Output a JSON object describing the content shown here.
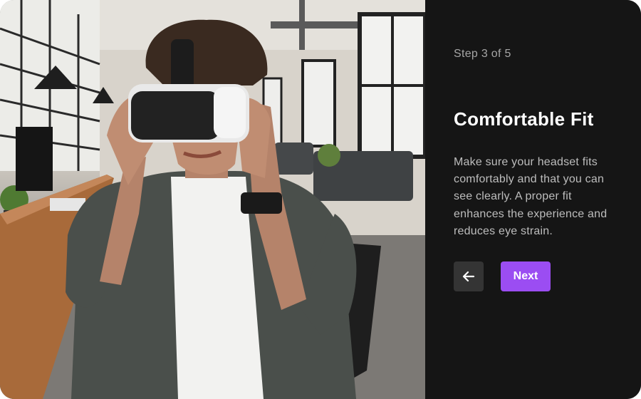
{
  "onboarding": {
    "step_indicator": "Step 3 of 5",
    "title": "Comfortable Fit",
    "description": "Make sure your headset fits comfortably and that you can see clearly. A proper fit enhances the experience and reduces eye strain.",
    "back_icon": "arrow-left-icon",
    "next_label": "Next"
  },
  "colors": {
    "panel_background": "#151515",
    "accent": "#9b4df2",
    "back_button": "#343434",
    "muted_text": "#a6a6a6"
  },
  "image": {
    "subject": "person wearing VR headset in office"
  }
}
